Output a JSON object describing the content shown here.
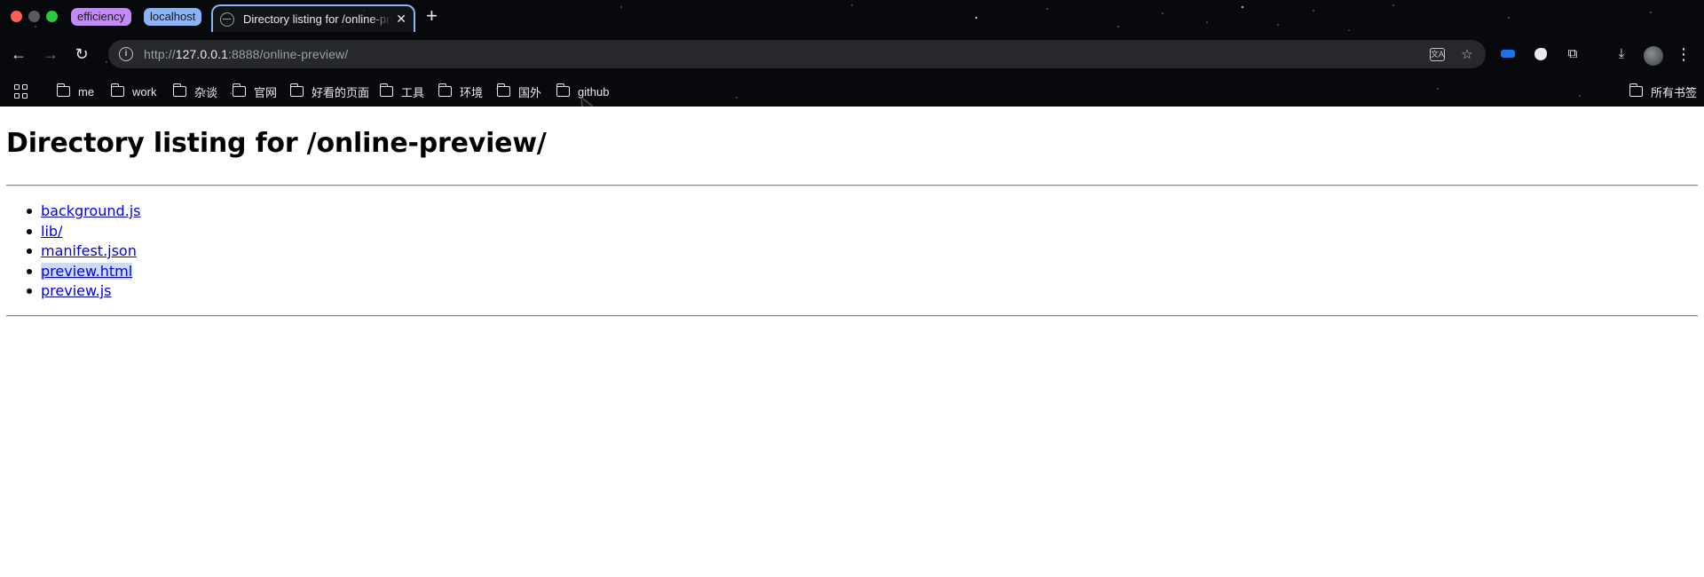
{
  "browser": {
    "tab_groups": [
      {
        "label": "efficiency",
        "color": "#c58af9"
      },
      {
        "label": "localhost",
        "color": "#8ab4f8"
      }
    ],
    "active_tab": {
      "title": "Directory listing for /online-preview/",
      "close_glyph": "✕"
    },
    "new_tab_glyph": "+",
    "url": {
      "scheme": "http://",
      "host": "127.0.0.1",
      "rest": ":8888/online-preview/"
    },
    "nav_icons": [
      "back-arrow-icon",
      "forward-arrow-icon",
      "reload-icon"
    ],
    "omnibox_icons": [
      "site-info-icon",
      "translate-icon",
      "bookmark-star-icon"
    ],
    "extension_icons": [
      "extension-1-icon",
      "extension-2-icon",
      "extensions-puzzle-icon",
      "download-icon",
      "profile-avatar",
      "menu-icon"
    ],
    "bookmarks": [
      "me",
      "work",
      "杂谈",
      "官网",
      "好看的页面",
      "工具",
      "环境",
      "国外",
      "github"
    ],
    "all_bookmarks": "所有书签"
  },
  "page": {
    "heading": "Directory listing for /online-preview/",
    "files": [
      "background.js",
      "lib/",
      "manifest.json",
      "preview.html",
      "preview.js"
    ],
    "highlighted_file": "preview.html"
  }
}
